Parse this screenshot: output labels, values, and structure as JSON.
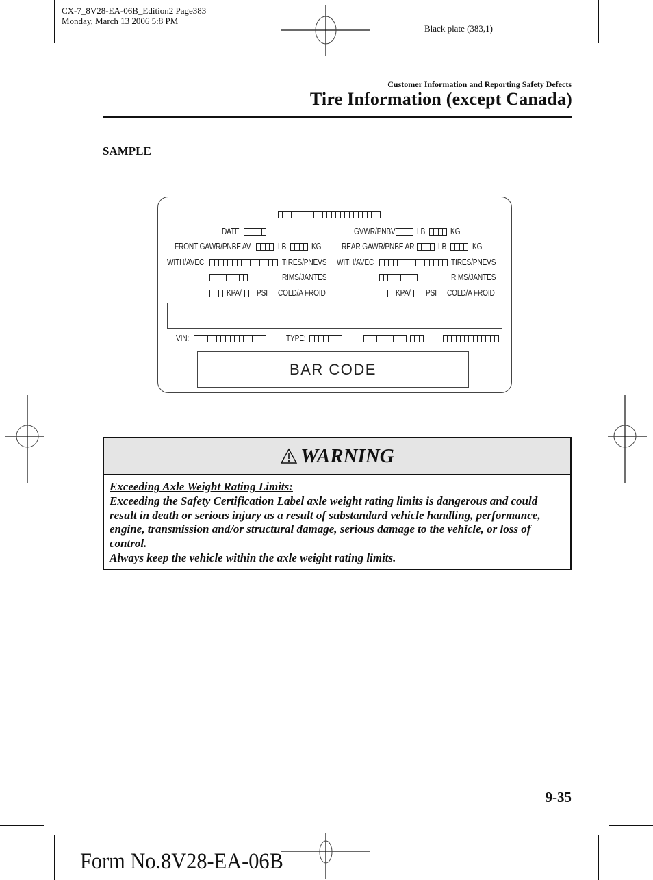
{
  "print_meta": {
    "file_line": "CX-7_8V28-EA-06B_Edition2 Page383",
    "date_line": "Monday, March 13 2006 5:8 PM",
    "plate": "Black plate (383,1)"
  },
  "header": {
    "section": "Customer Information and Reporting Safety Defects",
    "title": "Tire Information (except Canada)"
  },
  "sample_label": "SAMPLE",
  "tire_label": {
    "date": "DATE",
    "gvwr": "GVWR/PNBV",
    "front_gawr": "FRONT GAWR/PNBE AV",
    "rear_gawr": "REAR GAWR/PNBE AR",
    "lb": "LB",
    "kg": "KG",
    "with_avec": "WITH/AVEC",
    "tires": "TIRES/PNEVS",
    "rims": "RIMS/JANTES",
    "kpa": "KPA/",
    "psi": "PSI",
    "cold": "COLD/A FROID",
    "vin": "VIN:",
    "type": "TYPE:",
    "bar_code": "BAR CODE"
  },
  "warning": {
    "icon": "warning-triangle-icon",
    "title": "WARNING",
    "heading": "Exceeding Axle Weight Rating Limits:",
    "body": "Exceeding the Safety Certification Label axle weight rating limits is dangerous and could result in death or serious injury as a result of substandard vehicle handling, performance, engine, transmission and/or structural damage, serious damage to the vehicle, or loss of control.",
    "advice": "Always keep the vehicle within the axle weight rating limits."
  },
  "footer": {
    "page_number": "9-35",
    "form_number": "Form No.8V28-EA-06B"
  }
}
